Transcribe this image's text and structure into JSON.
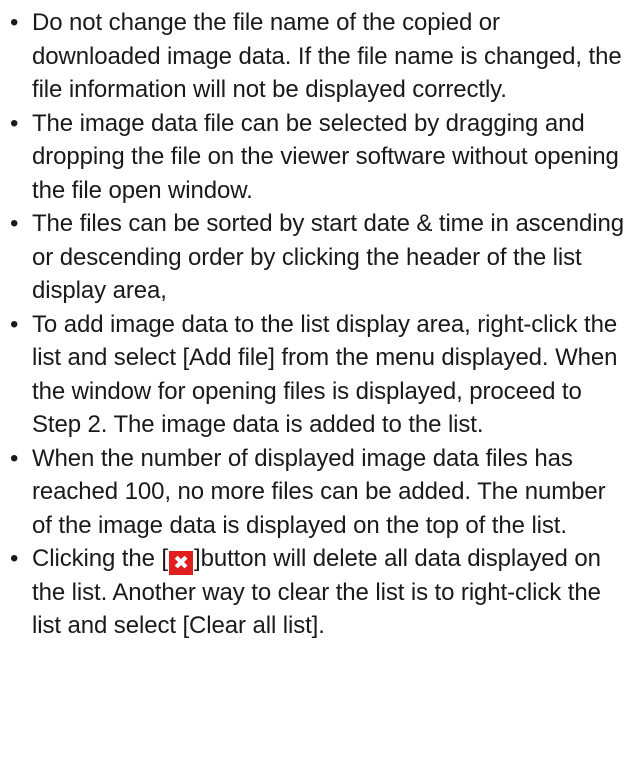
{
  "bullet_symbol": "•",
  "notes": [
    {
      "text": "Do not change the file name of the copied or downloaded image data. If the file name is changed, the file information will not be displayed correctly."
    },
    {
      "text": "The image data file can be selected by dragging and dropping the file on the viewer software without opening the file open window."
    },
    {
      "text": "The files can be sorted by start date & time in ascending or descending order by clicking the header of the list display area,"
    },
    {
      "text": "To add image data to the list display area, right-click the list and select [Add file] from the menu displayed. When the window for opening files is displayed, proceed to Step 2. The image data is added to the list."
    },
    {
      "text": "When the number of displayed image data files has reached 100, no more files can be added. The number of the image data is displayed on the top of the list."
    },
    {
      "before": "Clicking the [",
      "icon": "close-x-icon",
      "icon_glyph": "✖",
      "icon_color": "#e01e1e",
      "after": "]button will delete all data displayed on the list. Another way to clear the list is to right-click the list and select [Clear all list]."
    }
  ]
}
